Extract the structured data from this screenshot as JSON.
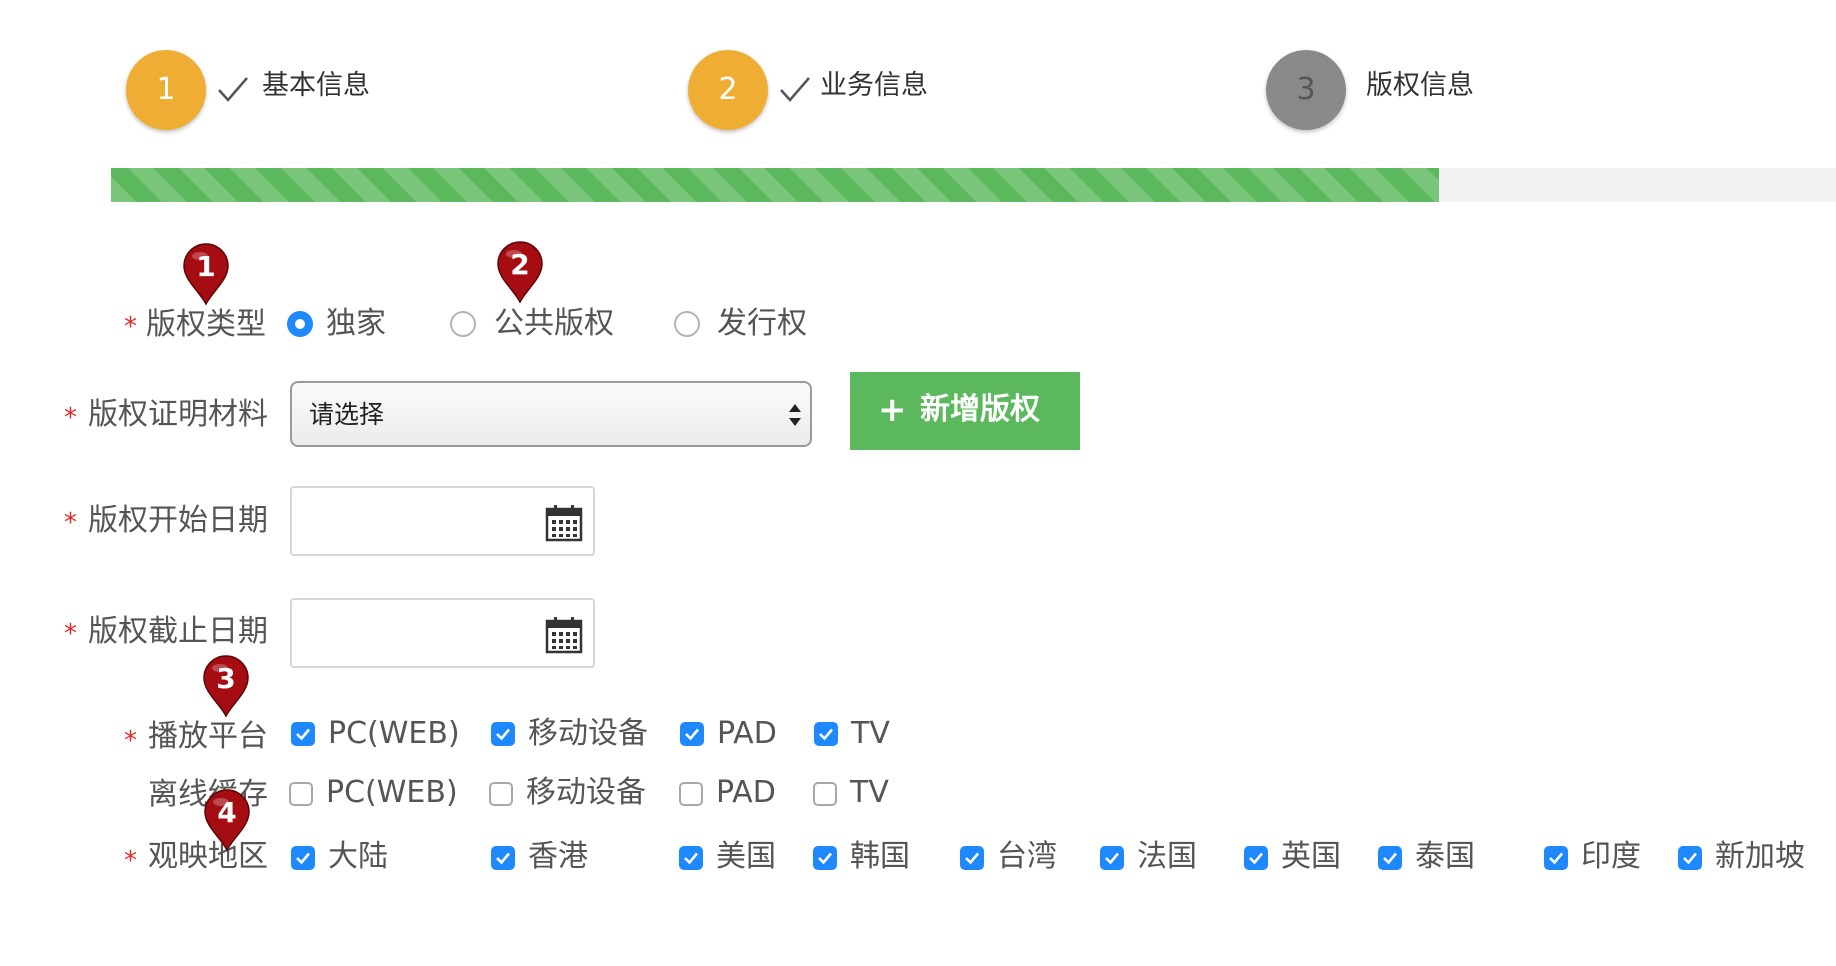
{
  "colors": {
    "step_done": "#f0ad34",
    "step_pending": "#8a8a8a",
    "progress": "#5cb85c",
    "primary_blue": "#1e88ff",
    "required_red": "#e02b2b",
    "marker": "#a60d12"
  },
  "steps": [
    {
      "number": "1",
      "label": "基本信息",
      "done": true
    },
    {
      "number": "2",
      "label": "业务信息",
      "done": true
    },
    {
      "number": "3",
      "label": "版权信息",
      "done": false
    }
  ],
  "progress": {
    "percent": 77
  },
  "form": {
    "required_mark": "*",
    "copyright_type": {
      "label": "版权类型",
      "options": [
        {
          "label": "独家",
          "checked": true
        },
        {
          "label": "公共版权",
          "checked": false
        },
        {
          "label": "发行权",
          "checked": false
        }
      ]
    },
    "proof": {
      "label": "版权证明材料",
      "select_value": "请选择",
      "add_button": {
        "plus": "+",
        "label": "新增版权"
      }
    },
    "start_date": {
      "label": "版权开始日期",
      "value": ""
    },
    "end_date": {
      "label": "版权截止日期",
      "value": ""
    },
    "platform": {
      "label": "播放平台",
      "options": [
        {
          "label": "PC(WEB)",
          "checked": true
        },
        {
          "label": "移动设备",
          "checked": true
        },
        {
          "label": "PAD",
          "checked": true
        },
        {
          "label": "TV",
          "checked": true
        }
      ]
    },
    "offline_cache": {
      "label": "离线缓存",
      "options": [
        {
          "label": "PC(WEB)",
          "checked": false
        },
        {
          "label": "移动设备",
          "checked": false
        },
        {
          "label": "PAD",
          "checked": false
        },
        {
          "label": "TV",
          "checked": false
        }
      ]
    },
    "region": {
      "label": "观映地区",
      "options": [
        {
          "label": "大陆",
          "checked": true
        },
        {
          "label": "香港",
          "checked": true
        },
        {
          "label": "美国",
          "checked": true
        },
        {
          "label": "韩国",
          "checked": true
        },
        {
          "label": "台湾",
          "checked": true
        },
        {
          "label": "法国",
          "checked": true
        },
        {
          "label": "英国",
          "checked": true
        },
        {
          "label": "泰国",
          "checked": true
        },
        {
          "label": "印度",
          "checked": true
        },
        {
          "label": "新加坡",
          "checked": true
        }
      ]
    }
  },
  "markers": [
    {
      "number": "1",
      "icon": "map-pin-icon"
    },
    {
      "number": "2",
      "icon": "map-pin-icon"
    },
    {
      "number": "3",
      "icon": "map-pin-icon"
    },
    {
      "number": "4",
      "icon": "map-pin-icon"
    }
  ]
}
